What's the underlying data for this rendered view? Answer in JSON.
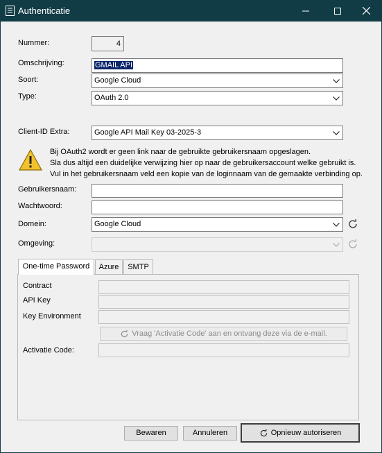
{
  "window": {
    "title": "Authenticatie",
    "icons": {
      "app": "form-icon",
      "minimize": "minimize-icon",
      "maximize": "maximize-icon",
      "close": "close-icon"
    }
  },
  "form": {
    "nummer_label": "Nummer:",
    "nummer_value": "4",
    "omschrijving_label": "Omschrijving:",
    "omschrijving_value": "GMAIL API",
    "soort_label": "Soort:",
    "soort_value": "Google Cloud",
    "type_label": "Type:",
    "type_value": "OAuth 2.0",
    "clientid_label": "Client-ID Extra:",
    "clientid_value": "Google API Mail Key 03-2025-3",
    "warning_lines": [
      "Bij OAuth2 wordt er geen link naar de gebruikte gebruikersnaam opgeslagen.",
      "Sla dus altijd een duidelijke verwijzing hier op naar de gebruikersaccount welke gebruikt is.",
      "Vul in het gebruikersnaam veld een kopie van de loginnaam van de gemaakte verbinding op."
    ],
    "gebruikersnaam_label": "Gebruikersnaam:",
    "gebruikersnaam_value": "",
    "wachtwoord_label": "Wachtwoord:",
    "wachtwoord_value": "",
    "domein_label": "Domein:",
    "domein_value": "Google Cloud",
    "omgeving_label": "Omgeving:",
    "omgeving_value": ""
  },
  "tabs": [
    {
      "label": "One-time Password",
      "active": true
    },
    {
      "label": "Azure",
      "active": false
    },
    {
      "label": "SMTP",
      "active": false
    }
  ],
  "otp": {
    "contract_label": "Contract",
    "apikey_label": "API Key",
    "keyenv_label": "Key Environment",
    "request_button": "Vraag 'Activatie Code' aan en ontvang deze via de e-mail.",
    "activatie_label": "Activatie Code:"
  },
  "footer": {
    "save": "Bewaren",
    "cancel": "Annuleren",
    "reauth": "Opnieuw autoriseren"
  },
  "colors": {
    "titlebar": "#113c46",
    "selection": "#0a246a",
    "warning": "#f2c12e"
  }
}
